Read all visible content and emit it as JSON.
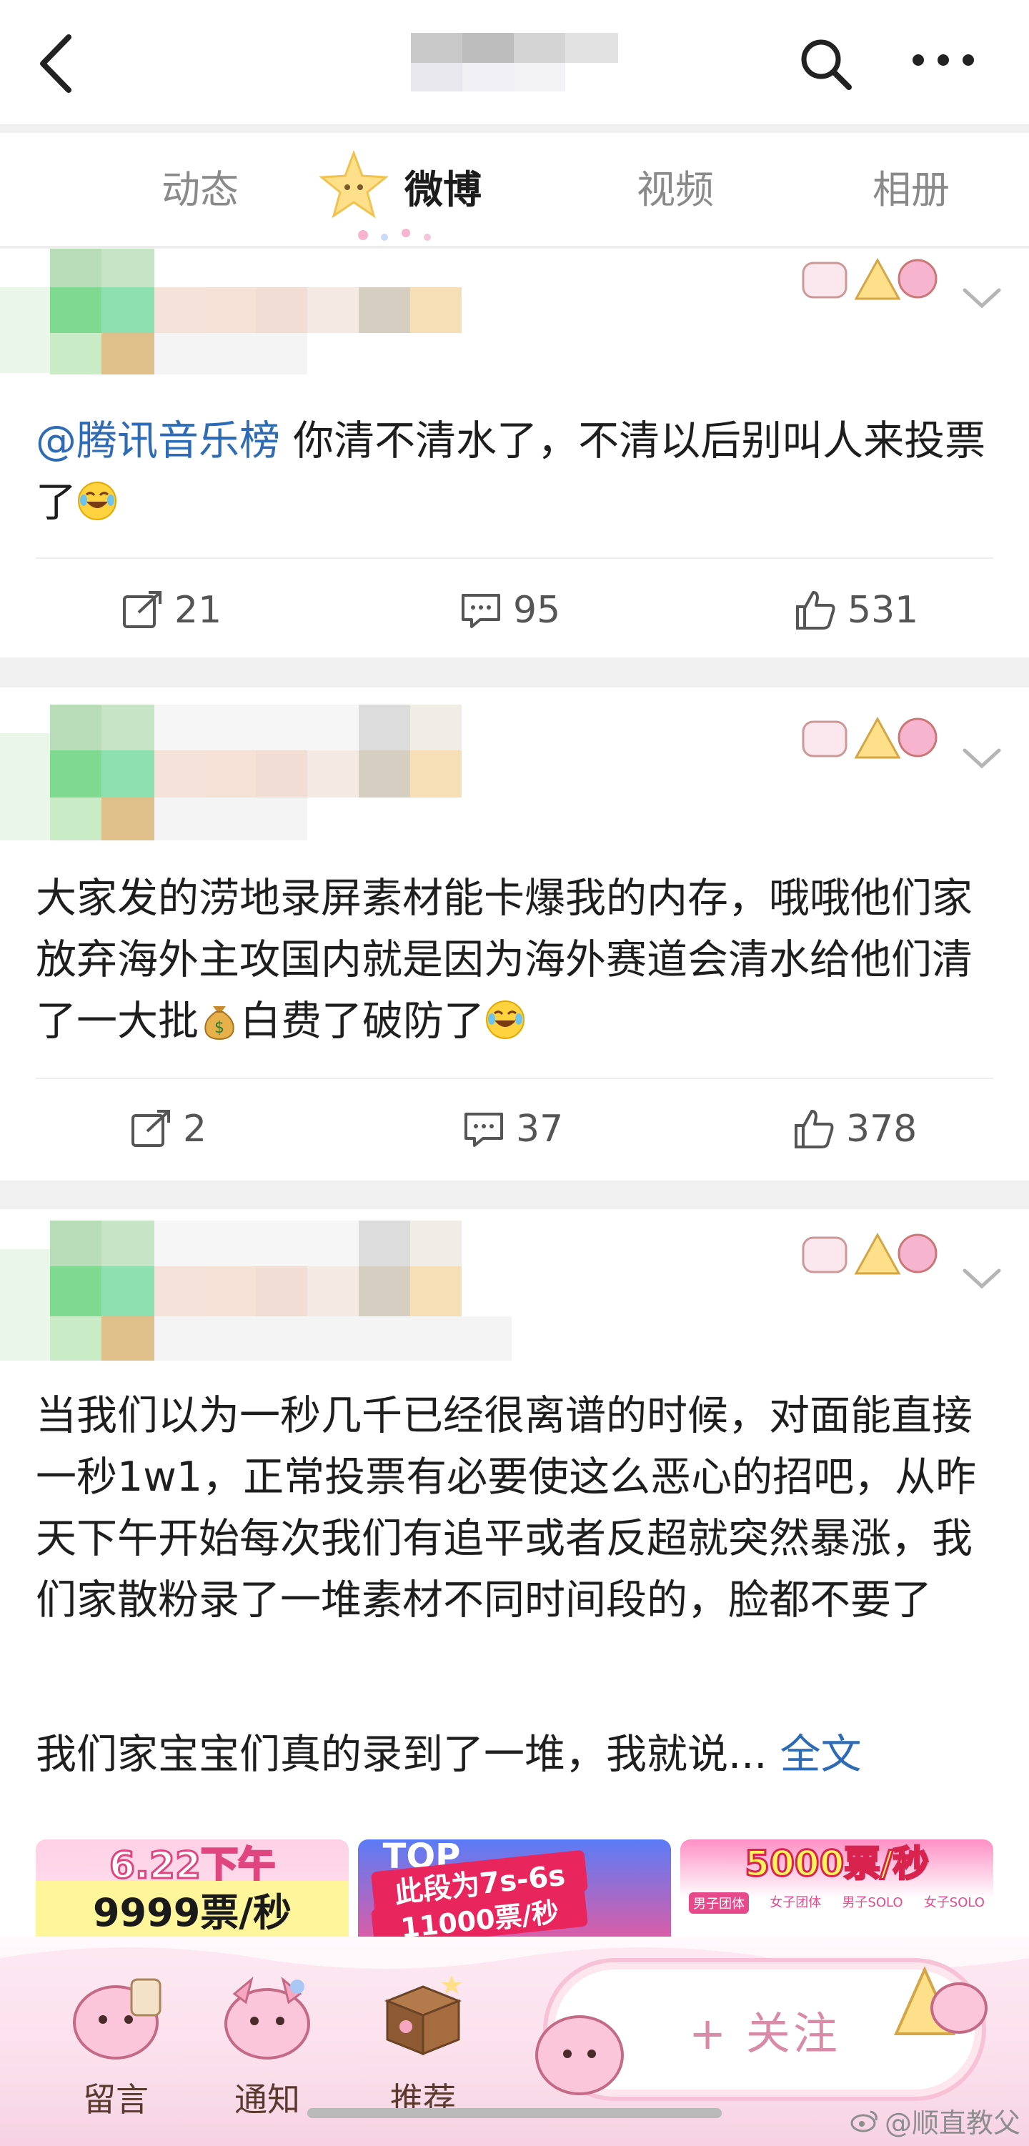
{
  "nav": {
    "tabs": [
      {
        "label": "动态",
        "active": false
      },
      {
        "label": "微博",
        "active": true
      },
      {
        "label": "视频",
        "active": false
      },
      {
        "label": "相册",
        "active": false
      }
    ]
  },
  "posts": [
    {
      "mention": "@腾讯音乐榜",
      "text": " 你清不清水了，不清以后别叫人来投票了",
      "reposts": "21",
      "comments": "95",
      "likes": "531"
    },
    {
      "text_a": "大家发的涝地录屏素材能卡爆我的内存，哦哦他们家放弃海外主攻国内就是因为海外赛道会清水给他们清了一大批",
      "text_b": "白费了破防了",
      "reposts": "2",
      "comments": "37",
      "likes": "378"
    },
    {
      "text": "当我们以为一秒几千已经很离谱的时候，对面能直接一秒1w1，正常投票有必要使这么恶心的招吧，从昨天下午开始每次我们有追平或者反超就突然暴涨，我们家散粉录了一堆素材不同时间段的，脸都不要了",
      "text2": "我们家宝宝们真的录到了一堆，我就说...",
      "fulltext_label": "全文",
      "thumbnails": [
        {
          "line1": "6.22下午",
          "line2": "9999票/秒"
        },
        {
          "line1": "此段为7s-6s",
          "line2": "11000票/秒",
          "tag": "TOP"
        },
        {
          "line1": "5000票/秒",
          "subtabs": [
            "男子团体",
            "女子团体",
            "男子SOLO",
            "女子SOLO"
          ]
        }
      ]
    }
  ],
  "bottom_bar": {
    "items": [
      {
        "label": "留言",
        "icon": "comment-sticker-icon"
      },
      {
        "label": "通知",
        "icon": "notification-sticker-icon"
      },
      {
        "label": "推荐",
        "icon": "recommend-box-icon"
      }
    ],
    "follow_label": "+ 关注"
  },
  "watermark": "@顺直教父",
  "colors": {
    "link": "#2e6bb7",
    "active_tab": "#1c1c1c",
    "inactive_tab": "#8a8a8a",
    "follow_accent": "#d98aa6"
  }
}
